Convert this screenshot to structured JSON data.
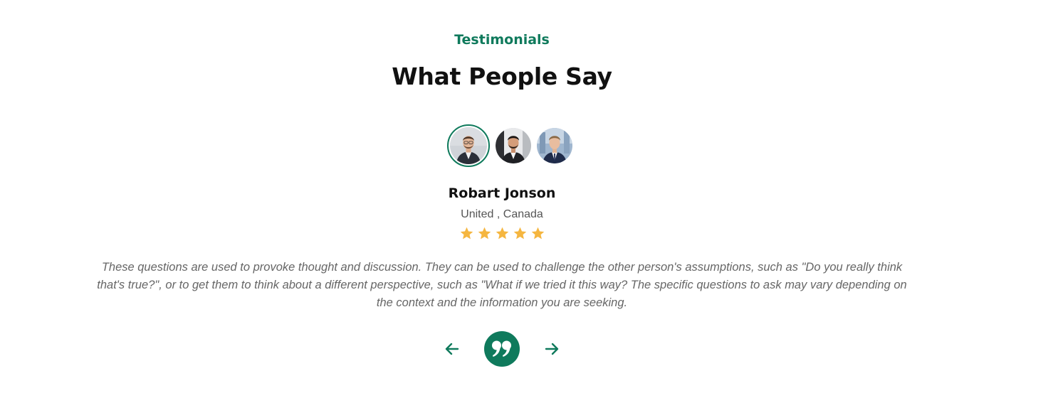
{
  "section": {
    "eyebrow": "Testimonials",
    "title": "What People Say"
  },
  "testimonial": {
    "name": "Robart Jonson",
    "location": "United , Canada",
    "rating": 5,
    "rating_max": 5,
    "quote": "These questions are used to provoke thought and discussion. They can be used to challenge the other person's assumptions, such as \"Do you really think that's true?\", or to get them to think about a different perspective, such as \"What if we tried it this way? The specific questions to ask may vary depending on the context and the information you are seeking."
  },
  "avatars": [
    {
      "icon": "person-photo",
      "active": true
    },
    {
      "icon": "person-photo",
      "active": false
    },
    {
      "icon": "person-photo",
      "active": false
    }
  ],
  "nav": {
    "prev_icon": "arrow-left-icon",
    "next_icon": "arrow-right-icon",
    "badge_icon": "quote-icon"
  },
  "colors": {
    "accent": "#0f7a5c",
    "star": "#f5b640",
    "heading": "#111111",
    "body_text": "#666666"
  }
}
